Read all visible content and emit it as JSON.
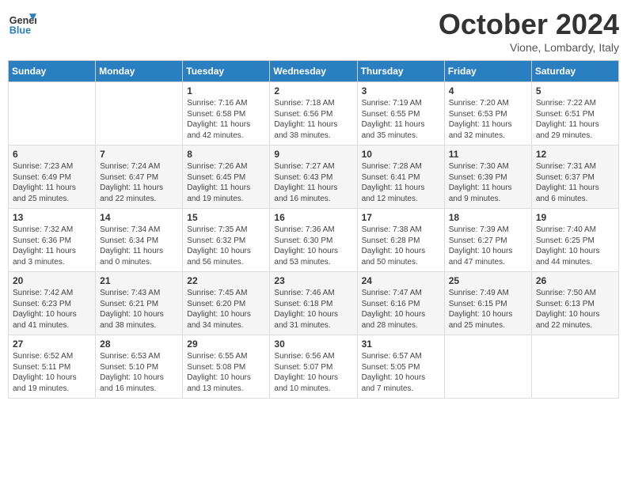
{
  "header": {
    "logo_line1": "General",
    "logo_line2": "Blue",
    "month": "October 2024",
    "location": "Vione, Lombardy, Italy"
  },
  "weekdays": [
    "Sunday",
    "Monday",
    "Tuesday",
    "Wednesday",
    "Thursday",
    "Friday",
    "Saturday"
  ],
  "weeks": [
    [
      {
        "day": "",
        "sunrise": "",
        "sunset": "",
        "daylight": ""
      },
      {
        "day": "",
        "sunrise": "",
        "sunset": "",
        "daylight": ""
      },
      {
        "day": "1",
        "sunrise": "Sunrise: 7:16 AM",
        "sunset": "Sunset: 6:58 PM",
        "daylight": "Daylight: 11 hours and 42 minutes."
      },
      {
        "day": "2",
        "sunrise": "Sunrise: 7:18 AM",
        "sunset": "Sunset: 6:56 PM",
        "daylight": "Daylight: 11 hours and 38 minutes."
      },
      {
        "day": "3",
        "sunrise": "Sunrise: 7:19 AM",
        "sunset": "Sunset: 6:55 PM",
        "daylight": "Daylight: 11 hours and 35 minutes."
      },
      {
        "day": "4",
        "sunrise": "Sunrise: 7:20 AM",
        "sunset": "Sunset: 6:53 PM",
        "daylight": "Daylight: 11 hours and 32 minutes."
      },
      {
        "day": "5",
        "sunrise": "Sunrise: 7:22 AM",
        "sunset": "Sunset: 6:51 PM",
        "daylight": "Daylight: 11 hours and 29 minutes."
      }
    ],
    [
      {
        "day": "6",
        "sunrise": "Sunrise: 7:23 AM",
        "sunset": "Sunset: 6:49 PM",
        "daylight": "Daylight: 11 hours and 25 minutes."
      },
      {
        "day": "7",
        "sunrise": "Sunrise: 7:24 AM",
        "sunset": "Sunset: 6:47 PM",
        "daylight": "Daylight: 11 hours and 22 minutes."
      },
      {
        "day": "8",
        "sunrise": "Sunrise: 7:26 AM",
        "sunset": "Sunset: 6:45 PM",
        "daylight": "Daylight: 11 hours and 19 minutes."
      },
      {
        "day": "9",
        "sunrise": "Sunrise: 7:27 AM",
        "sunset": "Sunset: 6:43 PM",
        "daylight": "Daylight: 11 hours and 16 minutes."
      },
      {
        "day": "10",
        "sunrise": "Sunrise: 7:28 AM",
        "sunset": "Sunset: 6:41 PM",
        "daylight": "Daylight: 11 hours and 12 minutes."
      },
      {
        "day": "11",
        "sunrise": "Sunrise: 7:30 AM",
        "sunset": "Sunset: 6:39 PM",
        "daylight": "Daylight: 11 hours and 9 minutes."
      },
      {
        "day": "12",
        "sunrise": "Sunrise: 7:31 AM",
        "sunset": "Sunset: 6:37 PM",
        "daylight": "Daylight: 11 hours and 6 minutes."
      }
    ],
    [
      {
        "day": "13",
        "sunrise": "Sunrise: 7:32 AM",
        "sunset": "Sunset: 6:36 PM",
        "daylight": "Daylight: 11 hours and 3 minutes."
      },
      {
        "day": "14",
        "sunrise": "Sunrise: 7:34 AM",
        "sunset": "Sunset: 6:34 PM",
        "daylight": "Daylight: 11 hours and 0 minutes."
      },
      {
        "day": "15",
        "sunrise": "Sunrise: 7:35 AM",
        "sunset": "Sunset: 6:32 PM",
        "daylight": "Daylight: 10 hours and 56 minutes."
      },
      {
        "day": "16",
        "sunrise": "Sunrise: 7:36 AM",
        "sunset": "Sunset: 6:30 PM",
        "daylight": "Daylight: 10 hours and 53 minutes."
      },
      {
        "day": "17",
        "sunrise": "Sunrise: 7:38 AM",
        "sunset": "Sunset: 6:28 PM",
        "daylight": "Daylight: 10 hours and 50 minutes."
      },
      {
        "day": "18",
        "sunrise": "Sunrise: 7:39 AM",
        "sunset": "Sunset: 6:27 PM",
        "daylight": "Daylight: 10 hours and 47 minutes."
      },
      {
        "day": "19",
        "sunrise": "Sunrise: 7:40 AM",
        "sunset": "Sunset: 6:25 PM",
        "daylight": "Daylight: 10 hours and 44 minutes."
      }
    ],
    [
      {
        "day": "20",
        "sunrise": "Sunrise: 7:42 AM",
        "sunset": "Sunset: 6:23 PM",
        "daylight": "Daylight: 10 hours and 41 minutes."
      },
      {
        "day": "21",
        "sunrise": "Sunrise: 7:43 AM",
        "sunset": "Sunset: 6:21 PM",
        "daylight": "Daylight: 10 hours and 38 minutes."
      },
      {
        "day": "22",
        "sunrise": "Sunrise: 7:45 AM",
        "sunset": "Sunset: 6:20 PM",
        "daylight": "Daylight: 10 hours and 34 minutes."
      },
      {
        "day": "23",
        "sunrise": "Sunrise: 7:46 AM",
        "sunset": "Sunset: 6:18 PM",
        "daylight": "Daylight: 10 hours and 31 minutes."
      },
      {
        "day": "24",
        "sunrise": "Sunrise: 7:47 AM",
        "sunset": "Sunset: 6:16 PM",
        "daylight": "Daylight: 10 hours and 28 minutes."
      },
      {
        "day": "25",
        "sunrise": "Sunrise: 7:49 AM",
        "sunset": "Sunset: 6:15 PM",
        "daylight": "Daylight: 10 hours and 25 minutes."
      },
      {
        "day": "26",
        "sunrise": "Sunrise: 7:50 AM",
        "sunset": "Sunset: 6:13 PM",
        "daylight": "Daylight: 10 hours and 22 minutes."
      }
    ],
    [
      {
        "day": "27",
        "sunrise": "Sunrise: 6:52 AM",
        "sunset": "Sunset: 5:11 PM",
        "daylight": "Daylight: 10 hours and 19 minutes."
      },
      {
        "day": "28",
        "sunrise": "Sunrise: 6:53 AM",
        "sunset": "Sunset: 5:10 PM",
        "daylight": "Daylight: 10 hours and 16 minutes."
      },
      {
        "day": "29",
        "sunrise": "Sunrise: 6:55 AM",
        "sunset": "Sunset: 5:08 PM",
        "daylight": "Daylight: 10 hours and 13 minutes."
      },
      {
        "day": "30",
        "sunrise": "Sunrise: 6:56 AM",
        "sunset": "Sunset: 5:07 PM",
        "daylight": "Daylight: 10 hours and 10 minutes."
      },
      {
        "day": "31",
        "sunrise": "Sunrise: 6:57 AM",
        "sunset": "Sunset: 5:05 PM",
        "daylight": "Daylight: 10 hours and 7 minutes."
      },
      {
        "day": "",
        "sunrise": "",
        "sunset": "",
        "daylight": ""
      },
      {
        "day": "",
        "sunrise": "",
        "sunset": "",
        "daylight": ""
      }
    ]
  ]
}
